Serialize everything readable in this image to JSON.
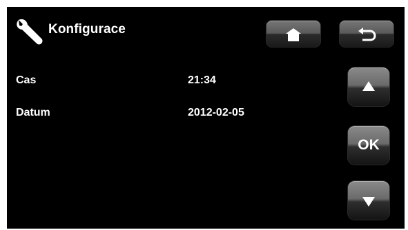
{
  "header": {
    "title": "Konfigurace",
    "icon": "wrench-icon",
    "home_icon": "home-icon",
    "back_icon": "back-arrow-icon"
  },
  "settings": [
    {
      "label": "Cas",
      "value": "21:34"
    },
    {
      "label": "Datum",
      "value": "2012-02-05"
    }
  ],
  "navigation": {
    "up_icon": "arrow-up-icon",
    "ok_label": "OK",
    "down_icon": "arrow-down-icon"
  },
  "colors": {
    "background": "#000000",
    "text": "#ffffff",
    "button": "#5a5a5a"
  }
}
